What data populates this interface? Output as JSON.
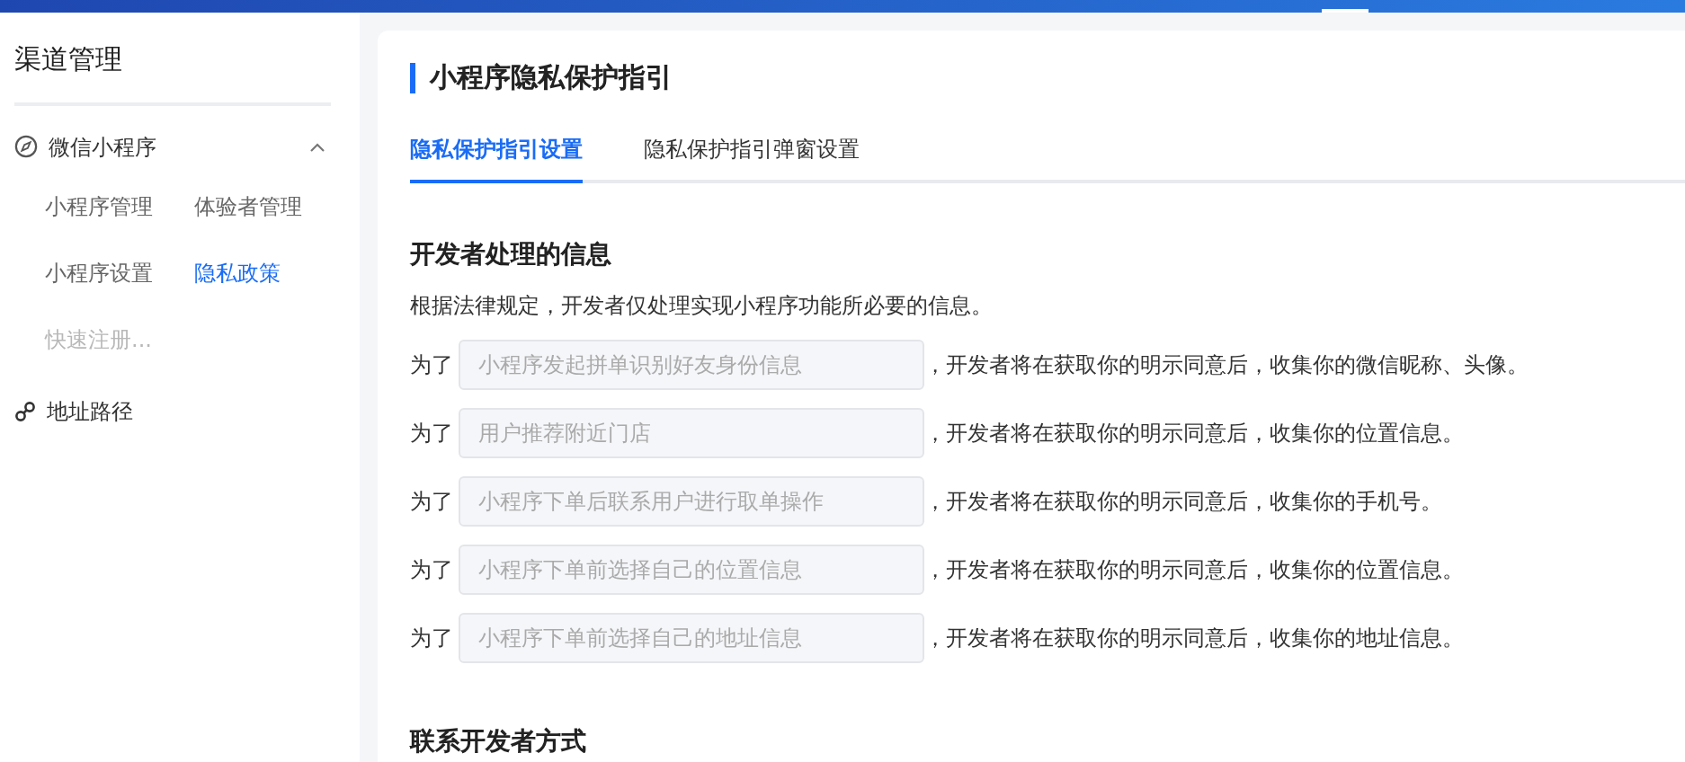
{
  "sidebar": {
    "title": "渠道管理",
    "groups": [
      {
        "label": "微信小程序",
        "expanded": true,
        "children": [
          {
            "label": "小程序管理",
            "selected": false,
            "disabled": false
          },
          {
            "label": "体验者管理",
            "selected": false,
            "disabled": false
          },
          {
            "label": "小程序设置",
            "selected": false,
            "disabled": false
          },
          {
            "label": "隐私政策",
            "selected": true,
            "disabled": false
          },
          {
            "label": "快速注册...",
            "selected": false,
            "disabled": true
          }
        ]
      },
      {
        "label": "地址路径"
      }
    ]
  },
  "page": {
    "title": "小程序隐私保护指引",
    "tabs": [
      {
        "label": "隐私保护指引设置",
        "selected": true
      },
      {
        "label": "隐私保护指引弹窗设置",
        "selected": false
      }
    ],
    "sections": [
      {
        "heading": "开发者处理的信息",
        "description": "根据法律规定，开发者仅处理实现小程序功能所必要的信息。",
        "rows": [
          {
            "prefix": "为了",
            "value": "小程序发起拼单识别好友身份信息",
            "disabled": true,
            "suffix": "，开发者将在获取你的明示同意后，收集你的微信昵称、头像。"
          },
          {
            "prefix": "为了",
            "value": "用户推荐附近门店",
            "disabled": true,
            "suffix": "，开发者将在获取你的明示同意后，收集你的位置信息。"
          },
          {
            "prefix": "为了",
            "value": "小程序下单后联系用户进行取单操作",
            "disabled": true,
            "suffix": "，开发者将在获取你的明示同意后，收集你的手机号。"
          },
          {
            "prefix": "为了",
            "value": "小程序下单前选择自己的位置信息",
            "disabled": true,
            "suffix": "，开发者将在获取你的明示同意后，收集你的位置信息。"
          },
          {
            "prefix": "为了",
            "value": "小程序下单前选择自己的地址信息",
            "disabled": true,
            "suffix": "，开发者将在获取你的明示同意后，收集你的地址信息。"
          }
        ]
      },
      {
        "heading": "联系开发者方式"
      }
    ]
  }
}
